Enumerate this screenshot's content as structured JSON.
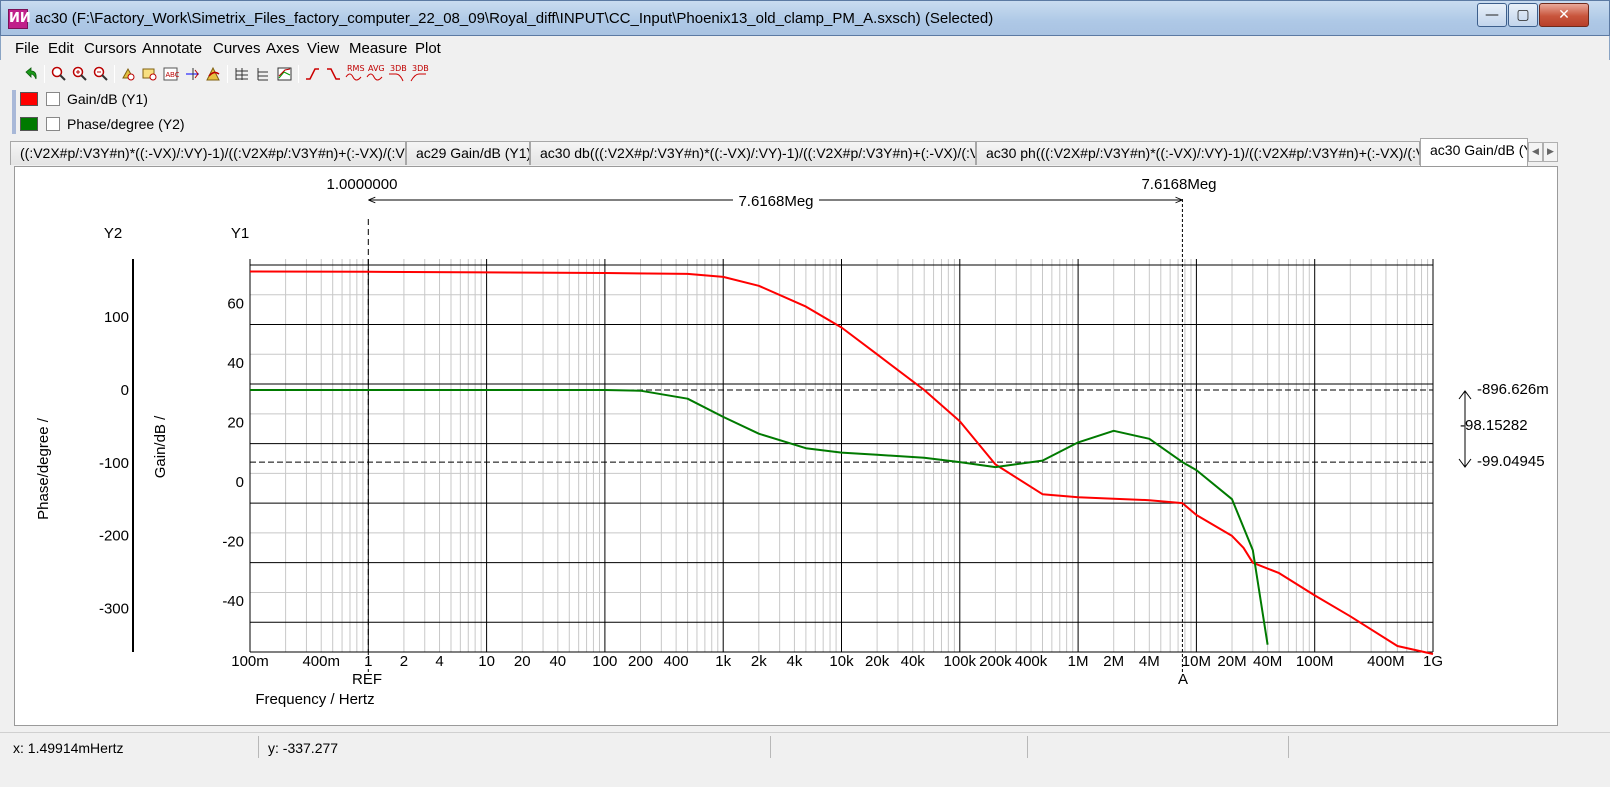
{
  "window": {
    "title": "ac30 (F:\\Factory_Work\\Simetrix_Files_factory_computer_22_08_09\\Royal_diff\\INPUT\\CC_Input\\Phoenix13_old_clamp_PM_A.sxsch) (Selected)",
    "icon_glyph": "ИИ"
  },
  "menu": [
    "File",
    "Edit",
    "Cursors",
    "Annotate",
    "Curves",
    "Axes",
    "View",
    "Measure",
    "Plot"
  ],
  "toolbar": {
    "icons": [
      "undo-icon",
      "zoom-full-icon",
      "zoom-in-icon",
      "zoom-out-icon",
      "pan-icon",
      "zoom-box-icon",
      "text-box-icon",
      "curve-marker-icon",
      "legend-icon",
      "grid-icon",
      "axis-icon",
      "probe-icon",
      "rise-icon",
      "fall-icon",
      "rms-icon",
      "avg-icon",
      "3db-low-icon",
      "3db-high-icon"
    ],
    "labels": {
      "rms": "RMS",
      "avg": "AVG",
      "db1": "3DB",
      "db2": "3DB"
    }
  },
  "legend": [
    {
      "label": "Gain/dB (Y1)",
      "color": "#ff0000"
    },
    {
      "label": "Phase/degree (Y2)",
      "color": "#007a00"
    }
  ],
  "tabs": [
    "((:V2X#p/:V3Y#n)*((:-VX)/:VY)-1)/((:V2X#p/:V3Y#n)+(:-VX)/(:VY)+2))",
    "ac29 Gain/dB (Y1)",
    "ac30 db(((:V2X#p/:V3Y#n)*((:-VX)/:VY)-1)/((:V2X#p/:V3Y#n)+(:-VX)/(:VY)+2))",
    "ac30 ph(((:V2X#p/:V3Y#n)*((:-VX)/:VY)-1)/((:V2X#p/:V3Y#n)+(:-VX)/(:VY)+2))",
    "ac30 Gain/dB (Y"
  ],
  "active_tab_index": 4,
  "plot": {
    "y2_axis_title": "Y2",
    "y1_axis_title": "Y1",
    "y2_label": "Phase/degree /",
    "y1_label": "Gain/dB /",
    "x_label": "Frequency / Hertz",
    "y1_ticks": [
      "60",
      "40",
      "20",
      "0",
      "-20",
      "-40"
    ],
    "y2_ticks": [
      "100",
      "0",
      "-100",
      "-200",
      "-300"
    ],
    "x_ticks": [
      "100m",
      "400m",
      "1",
      "2",
      "4",
      "10",
      "20",
      "40",
      "100",
      "200",
      "400",
      "1k",
      "2k",
      "4k",
      "10k",
      "20k",
      "40k",
      "100k",
      "200k",
      "400k",
      "1M",
      "2M",
      "4M",
      "10M",
      "20M",
      "40M",
      "100M",
      "400M",
      "1G"
    ]
  },
  "cursors": {
    "ref_label": "REF",
    "ref_value": "1.0000000",
    "a_label": "A",
    "a_value": "7.6168Meg",
    "delta_label": "7.6168Meg",
    "top_reading": "-896.626m",
    "mid_reading": "-98.15282",
    "bottom_reading": "-99.04945"
  },
  "status": {
    "x": "x: 1.49914mHertz",
    "y": "y: -337.277"
  },
  "chart_data": {
    "type": "line",
    "xscale": "log",
    "xlim": [
      0.1,
      1000000000
    ],
    "xlabel": "Frequency / Hertz",
    "y1label": "Gain/dB /",
    "y2label": "Phase/degree /",
    "y1lim": [
      -50,
      82
    ],
    "y2lim": [
      -360,
      180
    ],
    "grid": true,
    "series": [
      {
        "name": "Gain/dB (Y1)",
        "axis": "y1",
        "color": "#ff0000",
        "x": [
          0.1,
          1,
          10,
          100,
          500,
          1000,
          2000,
          5000,
          10000,
          20000,
          50000,
          100000,
          200000,
          500000,
          1000000,
          2000000,
          4000000,
          7616800,
          10000000,
          20000000,
          25000000,
          30000000,
          50000000,
          100000000,
          200000000,
          500000000,
          1000000000
        ],
        "y": [
          77.8,
          77.7,
          77.5,
          77.3,
          77,
          76,
          73,
          66,
          59,
          50,
          38,
          27.5,
          13,
          3,
          2,
          1.5,
          1,
          0,
          -4,
          -11,
          -15,
          -20,
          -23.5,
          -31,
          -38,
          -48,
          -56
        ]
      },
      {
        "name": "Phase/degree (Y2)",
        "axis": "y2",
        "color": "#007a00",
        "x": [
          0.1,
          1,
          10,
          100,
          200,
          500,
          1000,
          2000,
          5000,
          10000,
          20000,
          50000,
          100000,
          200000,
          500000,
          1000000,
          2000000,
          4000000,
          7616800,
          10000000,
          20000000,
          30000000,
          40000000
        ],
        "y": [
          0,
          0,
          0,
          0,
          -1,
          -12,
          -37,
          -60,
          -80,
          -86,
          -89,
          -93,
          -99,
          -106,
          -97,
          -72,
          -56,
          -67,
          -99,
          -110,
          -150,
          -220,
          -350
        ]
      }
    ]
  }
}
